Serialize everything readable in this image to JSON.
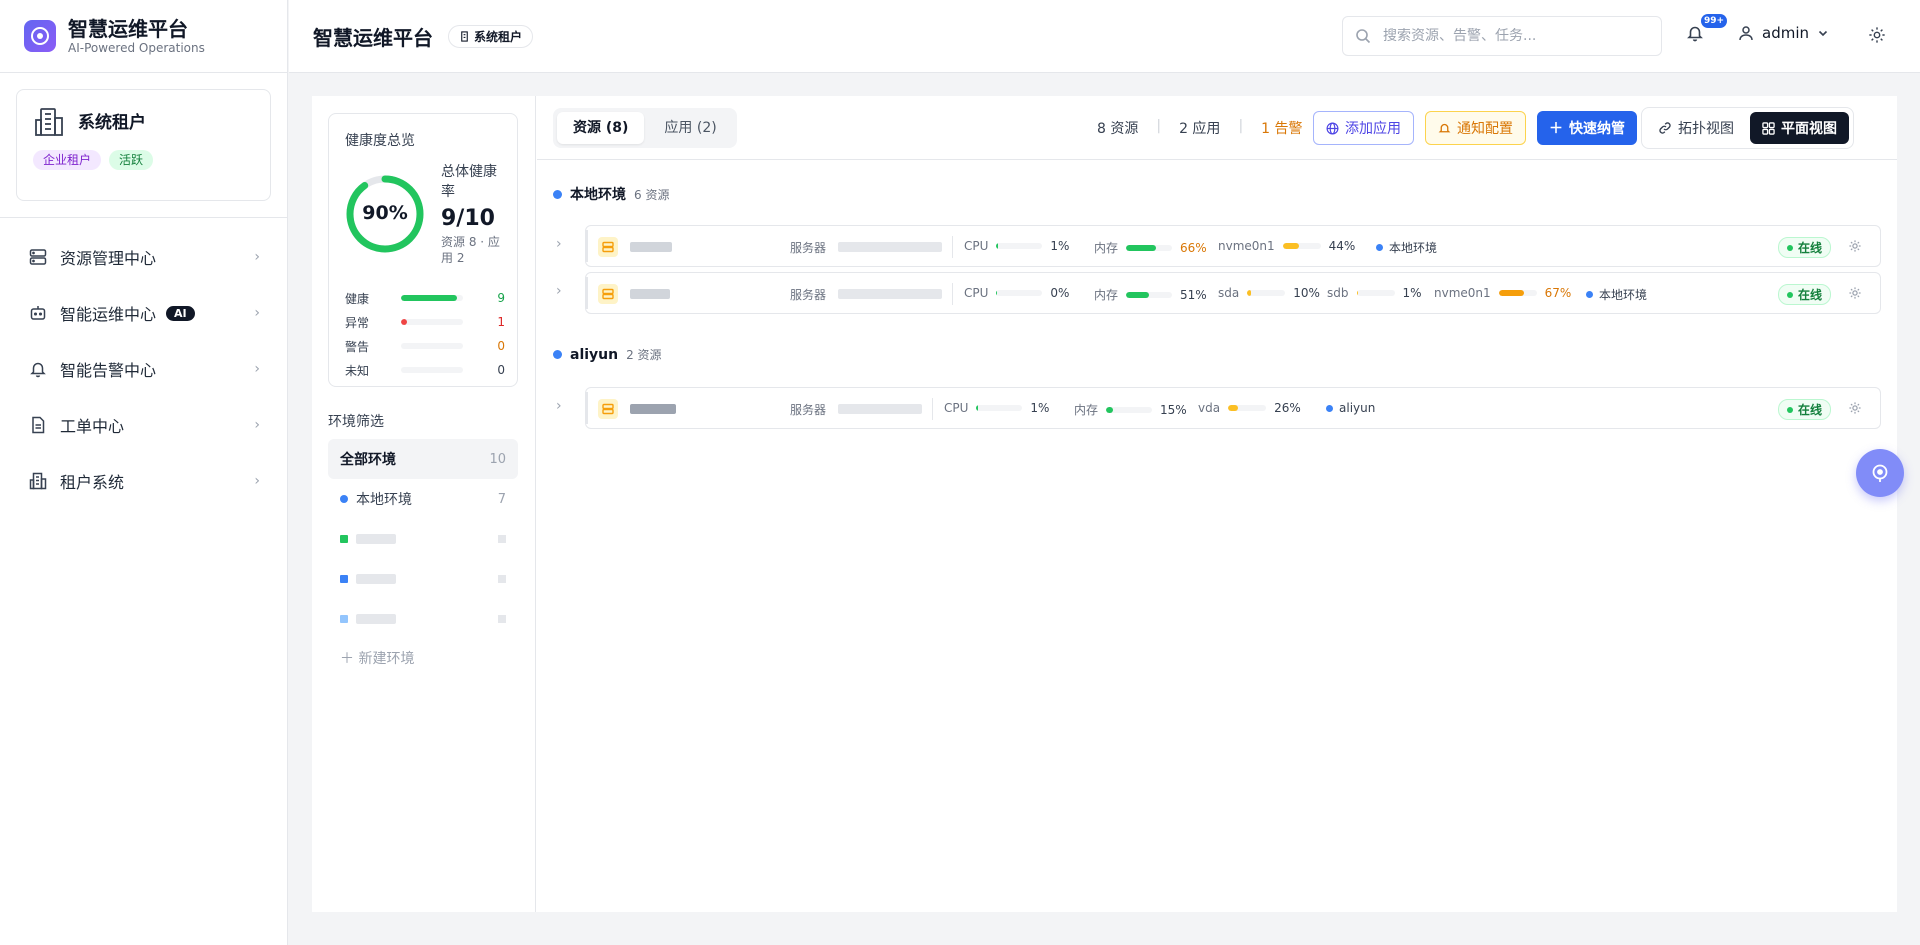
{
  "brand": {
    "title": "智慧运维平台",
    "subtitle": "AI-Powered Operations"
  },
  "tenant": {
    "name": "系统租户",
    "badges": [
      "企业租户",
      "活跃"
    ]
  },
  "nav": [
    {
      "label": "资源管理中心",
      "icon": "server-icon"
    },
    {
      "label": "智能运维中心",
      "icon": "robot-icon",
      "badge": "AI"
    },
    {
      "label": "智能告警中心",
      "icon": "bell-icon"
    },
    {
      "label": "工单中心",
      "icon": "document-icon"
    },
    {
      "label": "租户系统",
      "icon": "building-icon"
    }
  ],
  "header": {
    "title": "智慧运维平台",
    "tenant_chip": "系统租户",
    "search_placeholder": "搜索资源、告警、任务...",
    "notifications": "99+",
    "user": "admin"
  },
  "health": {
    "title": "健康度总览",
    "percent": 90,
    "percent_label": "90%",
    "overall_label": "总体健康率",
    "overall_value": "9/10",
    "overall_sub": "资源 8 · 应用 2",
    "rows": [
      {
        "label": "健康",
        "value": "9",
        "fraction": 0.9,
        "color": "#22c55e",
        "text_color": "#16a34a"
      },
      {
        "label": "异常",
        "value": "1",
        "fraction": 0.1,
        "color": "#ef4444",
        "text_color": "#dc2626"
      },
      {
        "label": "警告",
        "value": "0",
        "fraction": 0,
        "color": "#f59e0b",
        "text_color": "#d97706"
      },
      {
        "label": "未知",
        "value": "0",
        "fraction": 0,
        "color": "#9ca3af",
        "text_color": "#374151"
      }
    ]
  },
  "env_filter": {
    "title": "环境筛选",
    "all_label": "全部环境",
    "all_count": "10",
    "local_label": "本地环境",
    "local_count": "7",
    "add_label": "新建环境"
  },
  "toolbar": {
    "tab_resources": "资源 (8)",
    "tab_apps": "应用 (2)",
    "summary_resources": "8 资源",
    "summary_apps": "2 应用",
    "summary_alerts": "1 告警",
    "btn_add_app": "添加应用",
    "btn_notify": "通知配置",
    "btn_quick": "快速纳管",
    "view_topology": "拓扑视图",
    "view_flat": "平面视图"
  },
  "groups": [
    {
      "name": "本地环境",
      "count": "6 资源"
    },
    {
      "name": "aliyun",
      "count": "2 资源"
    }
  ],
  "rows": [
    {
      "kind": "服务器",
      "cpu_label": "CPU",
      "cpu": "1%",
      "cpu_frac": 0.01,
      "mem_label": "内存",
      "mem": "66%",
      "mem_frac": 0.66,
      "disks": [
        {
          "label": "nvme0n1",
          "value": "44%",
          "frac": 0.44
        }
      ],
      "env": "本地环境",
      "status": "在线"
    },
    {
      "kind": "服务器",
      "cpu_label": "CPU",
      "cpu": "0%",
      "cpu_frac": 0.0,
      "mem_label": "内存",
      "mem": "51%",
      "mem_frac": 0.51,
      "disks": [
        {
          "label": "sda",
          "value": "10%",
          "frac": 0.1
        },
        {
          "label": "sdb",
          "value": "1%",
          "frac": 0.01
        },
        {
          "label": "nvme0n1",
          "value": "67%",
          "frac": 0.67
        }
      ],
      "env": "本地环境",
      "status": "在线"
    },
    {
      "kind": "服务器",
      "cpu_label": "CPU",
      "cpu": "1%",
      "cpu_frac": 0.01,
      "mem_label": "内存",
      "mem": "15%",
      "mem_frac": 0.15,
      "disks": [
        {
          "label": "vda",
          "value": "26%",
          "frac": 0.26
        }
      ],
      "env": "aliyun",
      "status": "在线"
    }
  ]
}
